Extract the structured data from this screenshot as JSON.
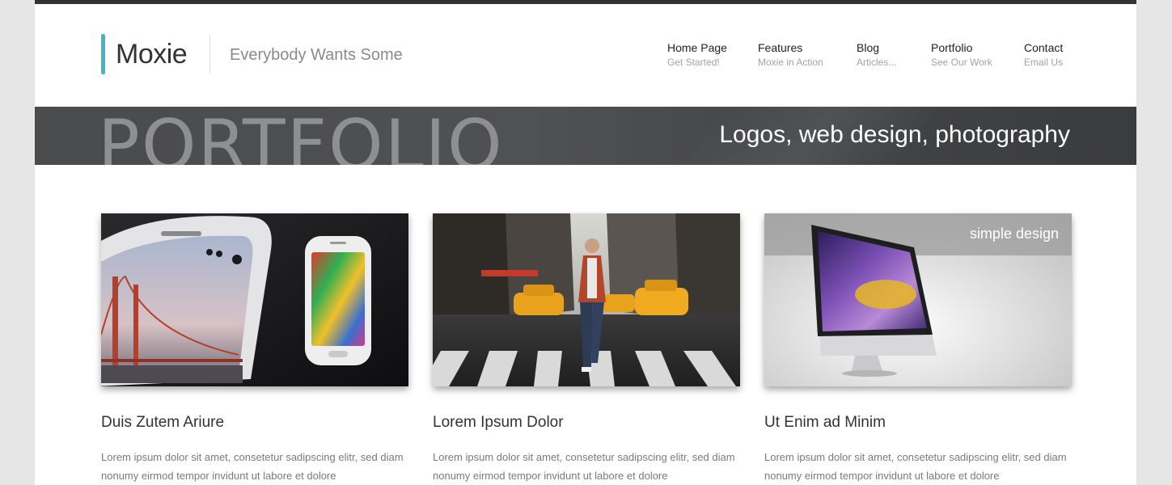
{
  "header": {
    "logo": "Moxie",
    "tagline": "Everybody Wants Some"
  },
  "nav": [
    {
      "title": "Home Page",
      "sub": "Get Started!"
    },
    {
      "title": "Features",
      "sub": "Moxie in Action"
    },
    {
      "title": "Blog",
      "sub": "Articles..."
    },
    {
      "title": "Portfolio",
      "sub": "See Our Work"
    },
    {
      "title": "Contact",
      "sub": "Email Us"
    }
  ],
  "banner": {
    "big_text": "PORTFOLIO",
    "subtitle": "Logos, web design, photography"
  },
  "portfolio": [
    {
      "title": "Duis Zutem Ariure",
      "text": "Lorem ipsum dolor sit amet, consetetur sadipscing elitr, sed diam nonumy eirmod tempor invidunt ut labore et dolore"
    },
    {
      "title": "Lorem Ipsum Dolor",
      "text": "Lorem ipsum dolor sit amet, consetetur sadipscing elitr, sed diam nonumy eirmod tempor invidunt ut labore et dolore"
    },
    {
      "title": "Ut Enim ad Minim",
      "text": "Lorem ipsum dolor sit amet, consetetur sadipscing elitr, sed diam nonumy eirmod tempor invidunt ut labore et dolore",
      "overlay_text": "simple design"
    }
  ],
  "colors": {
    "accent": "#3fb8c6",
    "banner": "#4a4b4d"
  }
}
